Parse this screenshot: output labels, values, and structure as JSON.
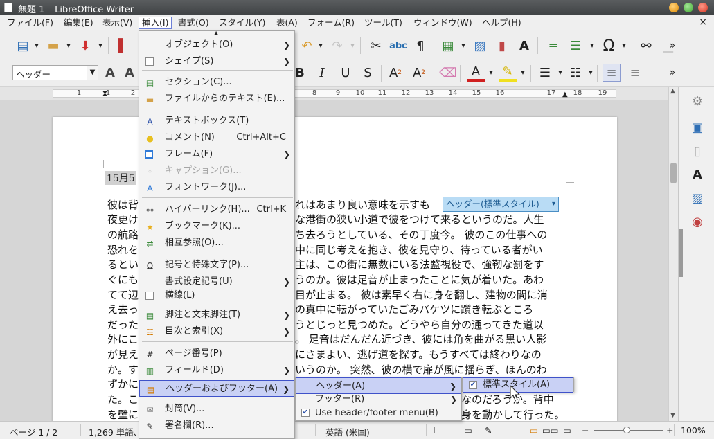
{
  "window": {
    "title": "無題 1 – LibreOffice Writer",
    "close_label": "×"
  },
  "menubar": {
    "items": [
      "ファイル(F)",
      "編集(E)",
      "表示(V)",
      "挿入(I)",
      "書式(O)",
      "スタイル(Y)",
      "表(A)",
      "フォーム(R)",
      "ツール(T)",
      "ウィンドウ(W)",
      "ヘルプ(H)"
    ]
  },
  "toolbar": {
    "paragraph_style": "ヘッダー"
  },
  "ruler": {
    "labels": [
      "1",
      "1",
      "2",
      "8",
      "9",
      "10",
      "11",
      "12",
      "13",
      "14",
      "15",
      "16",
      "17",
      "18",
      "19"
    ]
  },
  "document": {
    "header_date": "15月5",
    "header_tag": "ヘッダー(標準スタイル)",
    "lines": [
      {
        "left": "彼は背",
        "right": "れはあまり良い意味を示すも"
      },
      {
        "left": "夜更け",
        "right": "な港街の狭い小道で彼をつけて来るというのだ。人生"
      },
      {
        "left": "の航路",
        "right": "ち去ろうとしている、その丁度今。 彼のこの仕事への"
      },
      {
        "left": "恐れを",
        "right": "中に同じ考えを抱き、彼を見守り、待っている者がい"
      },
      {
        "left": "るとい",
        "right": "主は、この街に無数にいる法監視役で、強靭な罰をす"
      },
      {
        "left": "ぐにも",
        "right": "うのか。彼は足音が止まったことに気が着いた。あわ"
      },
      {
        "left": "てて辺",
        "right": "目が止まる。 彼は素早く右に身を翻し、建物の間に消"
      },
      {
        "left": "え去っ",
        "right": "の真中に転がっていたごみバケツに躓き転ぶところ"
      },
      {
        "left": "だった",
        "right": "うとじっと見つめた。どうやら自分の通ってきた道以"
      },
      {
        "left": "外にこ",
        "right": "。 足音はだんだん近づき、彼には角を曲がる黒い人影"
      },
      {
        "left": "が見え",
        "right": "にさまよい、逃げ道を探す。もうすべては終わりなの"
      },
      {
        "left": "か。す",
        "right": "いうのか。 突然、彼の横で扉が風に揺らぎ、ほんのわ"
      },
      {
        "left": "ずかに",
        "right": ""
      },
      {
        "left": "た。こ",
        "right": "なのだろうか。背中"
      },
      {
        "left": "を壁に",
        "right": "身を動かして行った。"
      }
    ]
  },
  "insert_menu": {
    "items": [
      {
        "label": "オブジェクト(O)",
        "submenu": true,
        "icon": "object-icon"
      },
      {
        "label": "シェイプ(S)",
        "submenu": true,
        "icon": "shape-icon"
      },
      {
        "label": "セクション(C)...",
        "icon": "section-icon"
      },
      {
        "label": "ファイルからのテキスト(E)...",
        "icon": "folder-icon"
      },
      {
        "label": "テキストボックス(T)",
        "icon": "textbox-icon"
      },
      {
        "label": "コメント(N)",
        "shortcut": "Ctrl+Alt+C",
        "icon": "comment-icon"
      },
      {
        "label": "フレーム(F)",
        "submenu": true,
        "icon": "frame-icon"
      },
      {
        "label": "キャプション(G)...",
        "disabled": true,
        "icon": "caption-icon"
      },
      {
        "label": "フォントワーク(J)...",
        "icon": "fontwork-icon"
      },
      {
        "label": "ハイパーリンク(H)...",
        "shortcut": "Ctrl+K",
        "icon": "hyperlink-icon"
      },
      {
        "label": "ブックマーク(K)...",
        "icon": "bookmark-icon"
      },
      {
        "label": "相互参照(O)...",
        "icon": "cross-reference-icon"
      },
      {
        "label": "記号と特殊文字(P)...",
        "icon": "omega-icon"
      },
      {
        "label": "書式設定記号(U)",
        "submenu": true
      },
      {
        "label": "横線(L)",
        "icon": "checkbox-icon"
      },
      {
        "label": "脚注と文末脚注(T)",
        "submenu": true,
        "icon": "footnote-icon"
      },
      {
        "label": "目次と索引(X)",
        "submenu": true,
        "icon": "toc-icon"
      },
      {
        "label": "ページ番号(P)",
        "icon": "hash-icon"
      },
      {
        "label": "フィールド(D)",
        "submenu": true,
        "icon": "field-icon"
      },
      {
        "label": "ヘッダーおよびフッター(A)",
        "submenu": true,
        "icon": "header-footer-icon"
      },
      {
        "label": "封筒(V)...",
        "icon": "envelope-icon"
      },
      {
        "label": "署名欄(R)...",
        "icon": "signature-icon"
      }
    ]
  },
  "header_footer_menu": {
    "items": [
      {
        "label": "ヘッダー(A)",
        "submenu": true
      },
      {
        "label": "フッター(R)",
        "submenu": true
      },
      {
        "label": "Use header/footer menu(B)",
        "checked": true
      }
    ]
  },
  "header_submenu": {
    "label": "標準スタイル(A)",
    "checked": true
  },
  "statusbar": {
    "page": "ページ 1 / 2",
    "words": "1,269 単語、",
    "language": "英語 (米国)",
    "zoom": "100%"
  }
}
